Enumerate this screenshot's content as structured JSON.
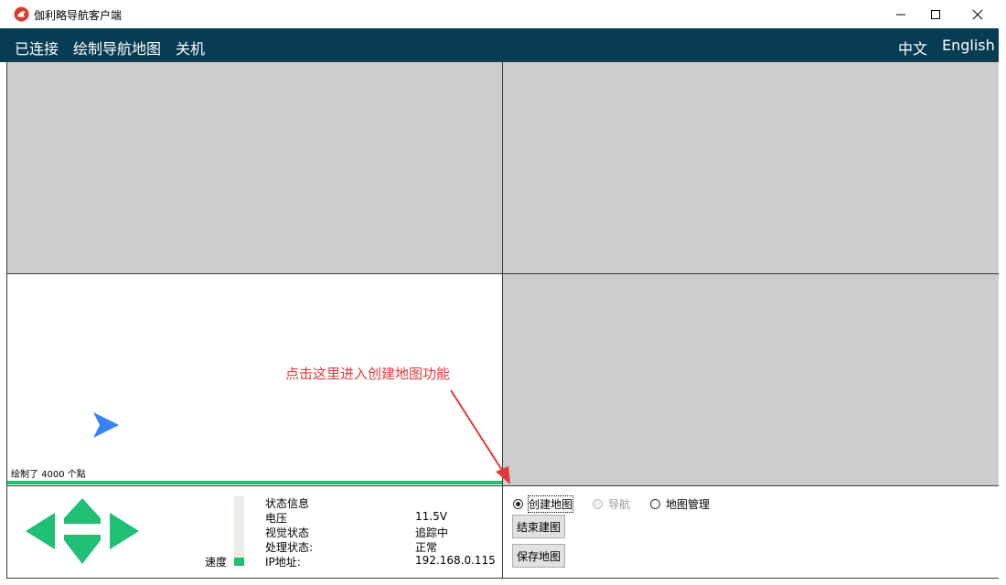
{
  "window": {
    "title": "伽利略导航客户端",
    "icon": "red-bird-app-icon",
    "controls": [
      "minimize-icon",
      "maximize-icon",
      "close-icon"
    ]
  },
  "menu": {
    "left": [
      "已连接",
      "绘制导航地图",
      "关机"
    ],
    "right": [
      "中文",
      "English"
    ],
    "background": "#073c55"
  },
  "map": {
    "points_label": "绘制了 4000 个點",
    "progress": 1.0,
    "robot_icon": "arrow-right-icon",
    "robot_color": "#3b82f6"
  },
  "annotation": {
    "text": "点击这里进入创建地图功能",
    "color": "#e23a3a"
  },
  "controls": {
    "direction_pad": [
      "arrow-up-icon",
      "arrow-left-icon",
      "arrow-right-icon",
      "arrow-down-icon"
    ],
    "pad_color": "#1fbf74",
    "speed_label": "速度",
    "speed_level": 0.12
  },
  "status": {
    "header": "状态信息",
    "rows": [
      {
        "label": "电压",
        "value": "11.5V"
      },
      {
        "label": "视觉状态",
        "value": "追踪中"
      },
      {
        "label": "处理状态:",
        "value": "正常"
      },
      {
        "label": "IP地址:",
        "value": "192.168.0.115"
      }
    ]
  },
  "mode": {
    "options": [
      {
        "label": "创建地图",
        "selected": true,
        "enabled": true
      },
      {
        "label": "导航",
        "selected": false,
        "enabled": false
      },
      {
        "label": "地图管理",
        "selected": false,
        "enabled": true
      }
    ],
    "buttons": [
      "结束建图",
      "保存地图"
    ]
  }
}
